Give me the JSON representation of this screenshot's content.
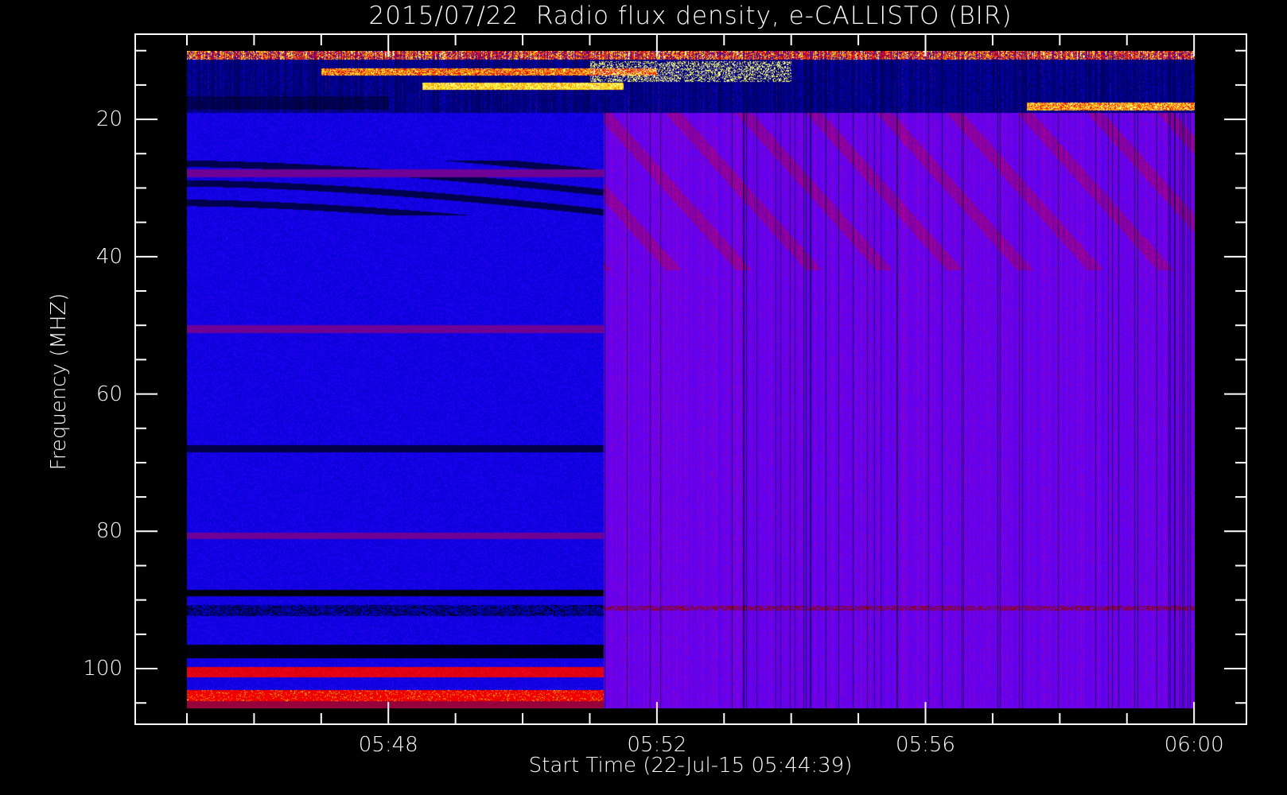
{
  "chart_data": {
    "type": "heatmap",
    "title": "2015/07/22  Radio flux density, e-CALLISTO (BIR)",
    "xlabel": "Start Time (22-Jul-15 05:44:39)",
    "ylabel": "Frequency (MHZ)",
    "x_units": "minutes after 05:45 UT",
    "xlim_minutes": [
      -0.77,
      15.78
    ],
    "data_x_range_minutes": [
      0,
      15
    ],
    "ylim_mhz": [
      108.1,
      7.6
    ],
    "data_y_range_mhz": [
      10,
      105.8
    ],
    "y_inverted": true,
    "x_ticks": [
      {
        "label": "05:48",
        "minutes": 3
      },
      {
        "label": "05:52",
        "minutes": 7
      },
      {
        "label": "05:56",
        "minutes": 11
      },
      {
        "label": "06:00",
        "minutes": 15
      }
    ],
    "x_minor_tick_step_minutes": 1,
    "y_ticks": [
      {
        "label": "20",
        "value": 20
      },
      {
        "label": "40",
        "value": 40
      },
      {
        "label": "60",
        "value": 60
      },
      {
        "label": "80",
        "value": 80
      },
      {
        "label": "100",
        "value": 100
      }
    ],
    "y_minor_tick_step_mhz": 5,
    "colormap": [
      "#000000",
      "#0000ff",
      "#8000a0",
      "#ff0000",
      "#ffff00"
    ],
    "features": {
      "instrument_change_minute": 6.2,
      "rfi_bursts_mhz": [
        10,
        19
      ],
      "bright_band_left_mhz": [
        [
          100,
          101.3
        ],
        [
          103,
          105
        ]
      ],
      "dark_band_left_mhz": [
        68,
        89,
        91.5,
        97.5
      ]
    }
  }
}
